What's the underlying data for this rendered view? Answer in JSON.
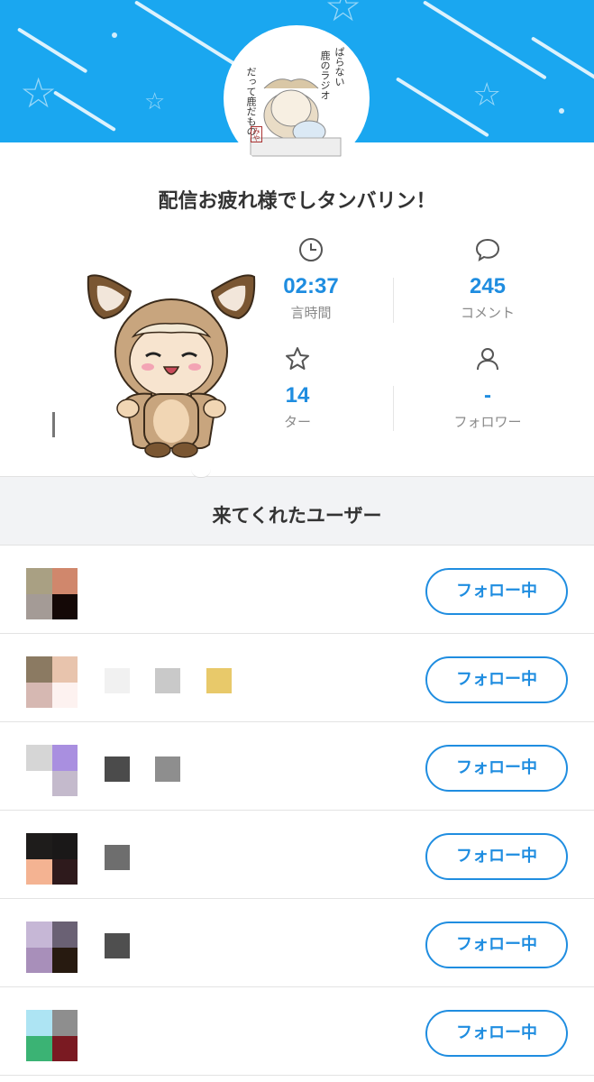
{
  "header": {
    "avatar_lines": [
      "ぱらない",
      "鹿のラジオ",
      "だって鹿だもの"
    ],
    "stamp": "みや"
  },
  "title": "配信お疲れ様でしタンバリン！",
  "stats": [
    {
      "icon": "clock-icon",
      "value": "02:37",
      "label": "配信時間"
    },
    {
      "icon": "comment-icon",
      "value": "245",
      "label": "コメント"
    },
    {
      "icon": "star-icon",
      "value": "14",
      "label": "スター"
    },
    {
      "icon": "person-icon",
      "value": "-",
      "label": "フォロワー"
    }
  ],
  "stats_visible": {
    "duration_value": "02:37",
    "duration_label": "言時間",
    "comment_value": "245",
    "comment_label": "コメント",
    "star_value": "14",
    "star_label": "ター",
    "follower_value": "-",
    "follower_label": "フォロワー"
  },
  "users_section": {
    "title": "来てくれたユーザー",
    "follow_label": "フォロー中",
    "rows": [
      {
        "avatar_colors": [
          "#a9a083",
          "#d0876c",
          "#a49b96",
          "#140806"
        ],
        "blocks": []
      },
      {
        "avatar_colors": [
          "#8b7a62",
          "#e8c4ad",
          "#d6b8b2",
          "#fdf2f0"
        ],
        "blocks": [
          "#f1f1f1",
          "#c9c9c9",
          "#e8c96a"
        ]
      },
      {
        "avatar_colors": [
          "#d6d6d6",
          "#a98fe0",
          "#ffffff",
          "#c4bacc"
        ],
        "blocks": [
          "#4b4b4b",
          "#8e8e8e"
        ]
      },
      {
        "avatar_colors": [
          "#1e1c1b",
          "#1a1818",
          "#f4b392",
          "#2e1a1c"
        ],
        "blocks": [
          "#6e6e6e"
        ]
      },
      {
        "avatar_colors": [
          "#c6b7d6",
          "#6a6174",
          "#a88fba",
          "#271a10"
        ],
        "blocks": [
          "#4f4f4f"
        ]
      },
      {
        "avatar_colors": [
          "#ade4f3",
          "#8e8e8e",
          "#3bb374",
          "#7a1a22"
        ],
        "blocks": []
      }
    ]
  },
  "colors": {
    "accent": "#1f8de0",
    "banner": "#1aa7f0",
    "section_bg": "#f2f3f5"
  }
}
